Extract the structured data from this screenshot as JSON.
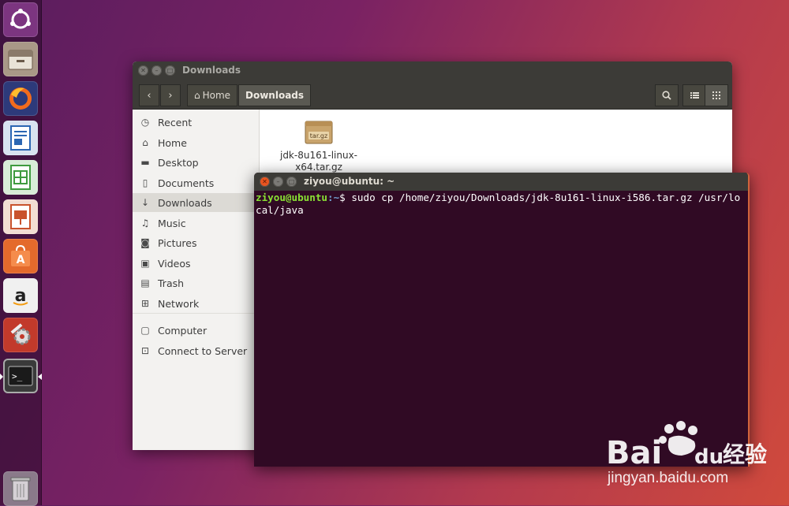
{
  "launcher": {
    "items": [
      {
        "name": "ubuntu-dash-icon",
        "color": "#7c3580"
      },
      {
        "name": "files-icon",
        "color": "#7a6a5a"
      },
      {
        "name": "firefox-icon",
        "color": "#2d3a7a"
      },
      {
        "name": "libreoffice-writer-icon",
        "color": "#2b66b3"
      },
      {
        "name": "libreoffice-calc-icon",
        "color": "#3f9b3f"
      },
      {
        "name": "libreoffice-impress-icon",
        "color": "#c9532d"
      },
      {
        "name": "ubuntu-software-icon",
        "color": "#e46a2c"
      },
      {
        "name": "amazon-icon",
        "color": "#e8e8e8"
      },
      {
        "name": "system-settings-icon",
        "color": "#c23a2b"
      },
      {
        "name": "terminal-icon",
        "color": "#2c2c2c"
      },
      {
        "name": "trash-icon",
        "color": "#9a8a9a"
      }
    ]
  },
  "file_manager": {
    "title": "Downloads",
    "breadcrumb_home": "Home",
    "breadcrumb_current": "Downloads",
    "sidebar": [
      {
        "label": "Recent",
        "icon": "clock-icon"
      },
      {
        "label": "Home",
        "icon": "home-icon"
      },
      {
        "label": "Desktop",
        "icon": "folder-icon"
      },
      {
        "label": "Documents",
        "icon": "document-icon"
      },
      {
        "label": "Downloads",
        "icon": "download-icon",
        "selected": true
      },
      {
        "label": "Music",
        "icon": "music-icon"
      },
      {
        "label": "Pictures",
        "icon": "camera-icon"
      },
      {
        "label": "Videos",
        "icon": "film-icon"
      },
      {
        "label": "Trash",
        "icon": "trash-icon"
      },
      {
        "label": "Network",
        "icon": "network-icon"
      },
      {
        "label": "Computer",
        "icon": "computer-icon"
      },
      {
        "label": "Connect to Server",
        "icon": "server-icon"
      }
    ],
    "file": {
      "name_line1": "jdk-8u161-linux-",
      "name_line2": "x64.tar.gz",
      "badge": "tar.gz"
    }
  },
  "terminal": {
    "title": "ziyou@ubuntu: ~",
    "prompt_user": "ziyou@ubuntu",
    "prompt_path": ":~",
    "prompt_symbol": "$ ",
    "command": "sudo cp /home/ziyou/Downloads/jdk-8u161-linux-i586.tar.gz /usr/local/java"
  },
  "watermark": {
    "brand": "Bai",
    "brand2": "du",
    "brand_cn": "经验",
    "url": "jingyan.baidu.com"
  }
}
